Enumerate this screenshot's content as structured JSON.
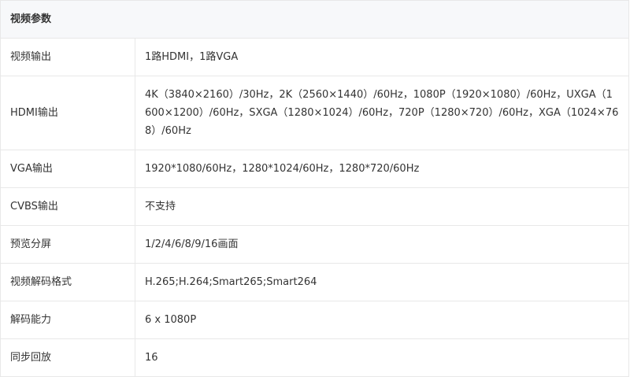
{
  "section": {
    "title": "视频参数"
  },
  "rows": [
    {
      "label": "视频输出",
      "value": "1路HDMI，1路VGA"
    },
    {
      "label": "HDMI输出",
      "value": "4K（3840×2160）/30Hz，2K（2560×1440）/60Hz，1080P（1920×1080）/60Hz，UXGA（1600×1200）/60Hz，SXGA（1280×1024）/60Hz，720P（1280×720）/60Hz，XGA（1024×768）/60Hz"
    },
    {
      "label": "VGA输出",
      "value": "1920*1080/60Hz，1280*1024/60Hz，1280*720/60Hz"
    },
    {
      "label": "CVBS输出",
      "value": "不支持"
    },
    {
      "label": "预览分屏",
      "value": "1/2/4/6/8/9/16画面"
    },
    {
      "label": "视频解码格式",
      "value": "H.265;H.264;Smart265;Smart264"
    },
    {
      "label": "解码能力",
      "value": "6 x 1080P"
    },
    {
      "label": "同步回放",
      "value": "16"
    }
  ]
}
